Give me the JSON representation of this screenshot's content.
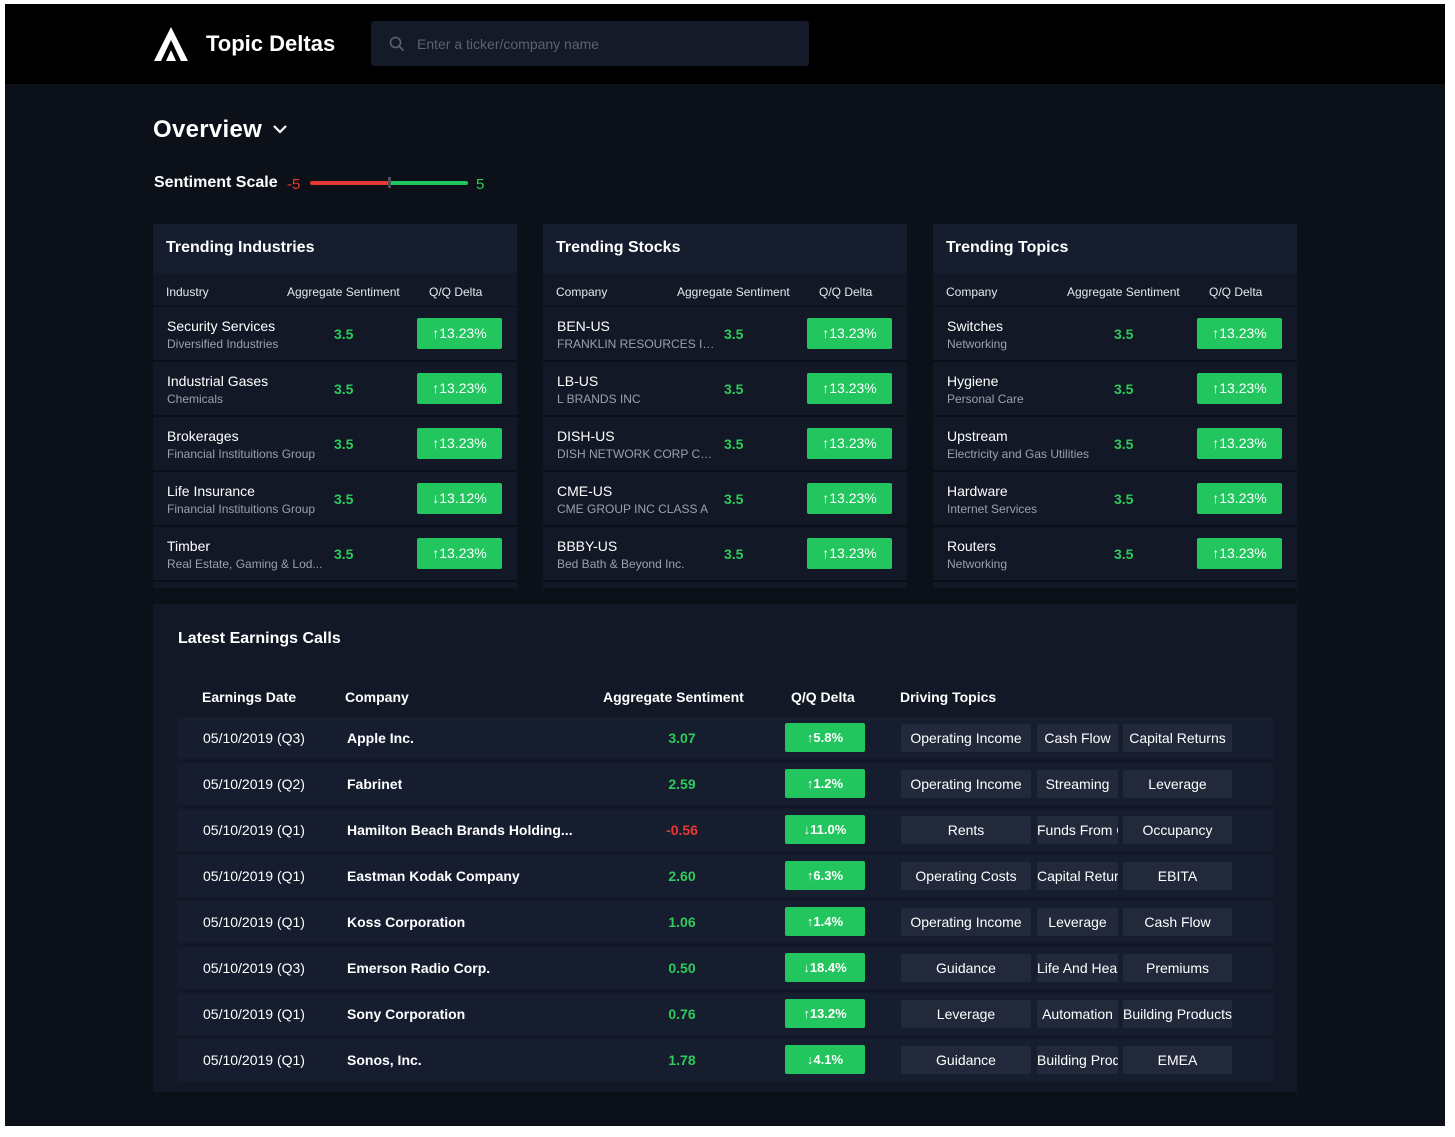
{
  "header": {
    "app_title": "Topic Deltas",
    "search_placeholder": "Enter a ticker/company name"
  },
  "overview": {
    "title": "Overview"
  },
  "sentiment_scale": {
    "label": "Sentiment Scale",
    "min": "-5",
    "max": "5",
    "neg_color": "#e53935",
    "pos_color": "#22c55e"
  },
  "trending_industries": {
    "title": "Trending Industries",
    "columns": [
      "Industry",
      "Aggregate Sentiment",
      "Q/Q Delta"
    ],
    "rows": [
      {
        "title": "Security Services",
        "sub": "Diversified Industries",
        "sentiment": "3.5",
        "delta": "↑13.23%"
      },
      {
        "title": "Industrial Gases",
        "sub": "Chemicals",
        "sentiment": "3.5",
        "delta": "↑13.23%"
      },
      {
        "title": "Brokerages",
        "sub": "Financial Instituitions Group",
        "sentiment": "3.5",
        "delta": "↑13.23%"
      },
      {
        "title": "Life Insurance",
        "sub": "Financial Instituitions Group",
        "sentiment": "3.5",
        "delta": "↓13.12%"
      },
      {
        "title": "Timber",
        "sub": "Real Estate, Gaming & Lod...",
        "sentiment": "3.5",
        "delta": "↑13.23%"
      }
    ]
  },
  "trending_stocks": {
    "title": "Trending Stocks",
    "columns": [
      "Company",
      "Aggregate Sentiment",
      "Q/Q Delta"
    ],
    "rows": [
      {
        "title": "BEN-US",
        "sub": "FRANKLIN RESOURCES INC",
        "sentiment": "3.5",
        "delta": "↑13.23%"
      },
      {
        "title": "LB-US",
        "sub": "L BRANDS INC",
        "sentiment": "3.5",
        "delta": "↑13.23%"
      },
      {
        "title": "DISH-US",
        "sub": "DISH NETWORK CORP CLA...",
        "sentiment": "3.5",
        "delta": "↑13.23%"
      },
      {
        "title": "CME-US",
        "sub": "CME GROUP INC CLASS A",
        "sentiment": "3.5",
        "delta": "↑13.23%"
      },
      {
        "title": "BBBY-US",
        "sub": "Bed Bath & Beyond Inc.",
        "sentiment": "3.5",
        "delta": "↑13.23%"
      }
    ]
  },
  "trending_topics": {
    "title": "Trending Topics",
    "columns": [
      "Company",
      "Aggregate Sentiment",
      "Q/Q Delta"
    ],
    "rows": [
      {
        "title": "Switches",
        "sub": "Networking",
        "sentiment": "3.5",
        "delta": "↑13.23%"
      },
      {
        "title": "Hygiene",
        "sub": "Personal Care",
        "sentiment": "3.5",
        "delta": "↑13.23%"
      },
      {
        "title": "Upstream",
        "sub": "Electricity and Gas Utilities",
        "sentiment": "3.5",
        "delta": "↑13.23%"
      },
      {
        "title": "Hardware",
        "sub": "Internet Services",
        "sentiment": "3.5",
        "delta": "↑13.23%"
      },
      {
        "title": "Routers",
        "sub": "Networking",
        "sentiment": "3.5",
        "delta": "↑13.23%"
      }
    ]
  },
  "earnings": {
    "title": "Latest Earnings Calls",
    "columns": [
      "Earnings Date",
      "Company",
      "Aggregate Sentiment",
      "Q/Q Delta",
      "Driving Topics"
    ],
    "rows": [
      {
        "date": "05/10/2019 (Q3)",
        "company": "Apple Inc.",
        "sentiment": "3.07",
        "delta": "↑5.8%",
        "topics": [
          "Operating Income",
          "Cash Flow",
          "Capital Returns"
        ]
      },
      {
        "date": "05/10/2019 (Q2)",
        "company": "Fabrinet",
        "sentiment": "2.59",
        "delta": "↑1.2%",
        "topics": [
          "Operating Income",
          "Streaming",
          "Leverage"
        ]
      },
      {
        "date": "05/10/2019 (Q1)",
        "company": "Hamilton Beach Brands Holding...",
        "sentiment": "-0.56",
        "delta": "↓11.0%",
        "topics": [
          "Rents",
          "Funds From Operat",
          "Occupancy"
        ]
      },
      {
        "date": "05/10/2019 (Q1)",
        "company": "Eastman Kodak Company",
        "sentiment": "2.60",
        "delta": "↑6.3%",
        "topics": [
          "Operating Costs",
          "Capital Returns",
          "EBITA"
        ]
      },
      {
        "date": "05/10/2019 (Q1)",
        "company": "Koss Corporation",
        "sentiment": "1.06",
        "delta": "↑1.4%",
        "topics": [
          "Operating Income",
          "Leverage",
          "Cash Flow"
        ]
      },
      {
        "date": "05/10/2019 (Q3)",
        "company": "Emerson Radio Corp.",
        "sentiment": "0.50",
        "delta": "↓18.4%",
        "topics": [
          "Guidance",
          "Life And Health Insu",
          "Premiums"
        ]
      },
      {
        "date": "05/10/2019 (Q1)",
        "company": "Sony Corporation",
        "sentiment": "0.76",
        "delta": "↑13.2%",
        "topics": [
          "Leverage",
          "Automation",
          "Building Products"
        ]
      },
      {
        "date": "05/10/2019 (Q1)",
        "company": "Sonos, Inc.",
        "sentiment": "1.78",
        "delta": "↓4.1%",
        "topics": [
          "Guidance",
          "Building Product",
          "EMEA"
        ]
      }
    ]
  },
  "colors": {
    "positive": "#2ecc5a",
    "negative": "#e53935",
    "delta_bg": "#22c55e",
    "panel": "#121826",
    "background": "#0c1019"
  }
}
